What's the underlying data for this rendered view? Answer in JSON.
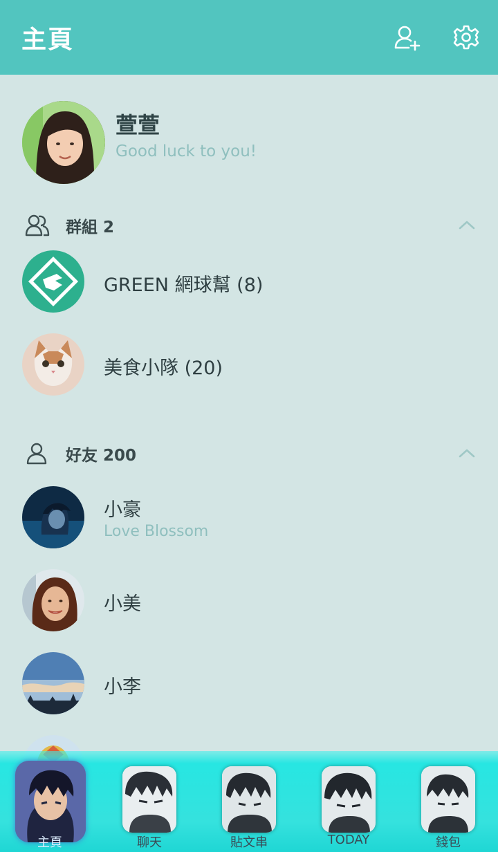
{
  "header": {
    "title": "主頁",
    "add_friend_icon": "add-person-icon",
    "settings_icon": "gear-icon"
  },
  "profile": {
    "name": "萱萱",
    "status": "Good luck to you!"
  },
  "groups": {
    "label": "群組 2",
    "items": [
      {
        "name": "GREEN 網球幫 (8)"
      },
      {
        "name": "美食小隊 (20)"
      }
    ]
  },
  "friends": {
    "label": "好友 200",
    "items": [
      {
        "name": "小豪",
        "status": "Love Blossom"
      },
      {
        "name": "小美"
      },
      {
        "name": "小李"
      }
    ]
  },
  "tabbar": {
    "tabs": [
      {
        "label": "主頁",
        "active": true
      },
      {
        "label": "聊天"
      },
      {
        "label": "貼文串"
      },
      {
        "label": "TODAY"
      },
      {
        "label": "錢包"
      }
    ]
  },
  "colors": {
    "header": "#52c5bf",
    "background": "#d3e5e4",
    "tabbar": "#27e6e2",
    "status_text": "#8fbfbe"
  }
}
